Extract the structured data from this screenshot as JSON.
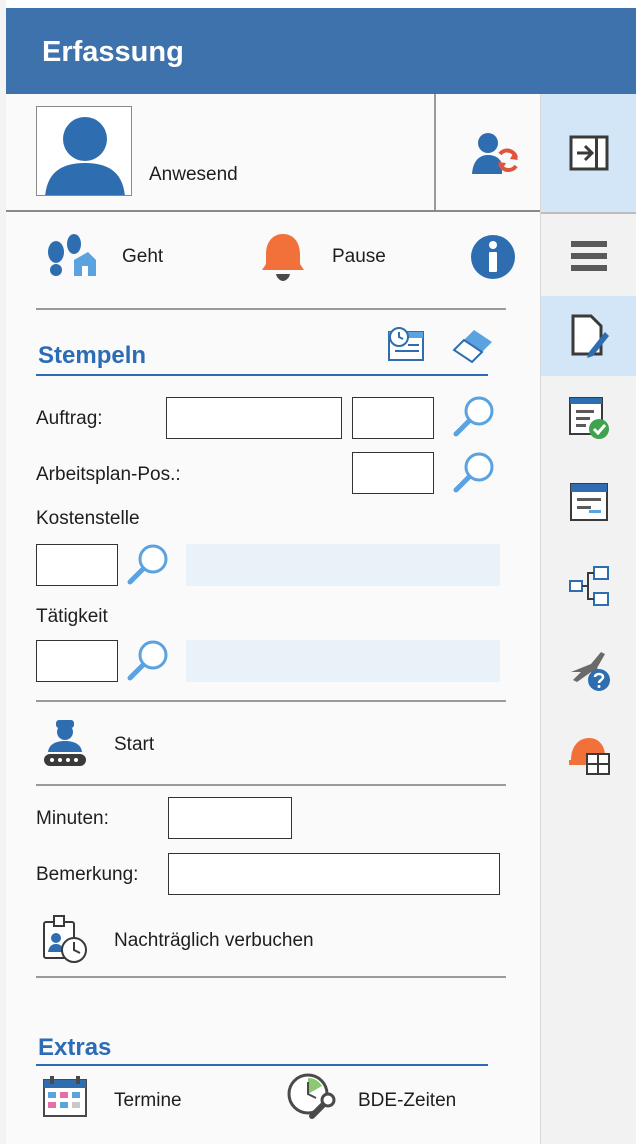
{
  "window": {
    "title": "Erfassung"
  },
  "status": {
    "text": "Anwesend"
  },
  "actions": {
    "geht": "Geht",
    "pause": "Pause"
  },
  "stempeln": {
    "title": "Stempeln",
    "auftrag_label": "Auftrag:",
    "arbeitsplan_label": "Arbeitsplan-Pos.:",
    "kostenstelle_label": "Kostenstelle",
    "taetigkeit_label": "Tätigkeit",
    "start_label": "Start",
    "auftrag_value": "",
    "auftrag_pos_value": "",
    "arbeitsplan_value": "",
    "kostenstelle_value": "",
    "taetigkeit_value": ""
  },
  "booking": {
    "minuten_label": "Minuten:",
    "minuten_value": "",
    "bemerkung_label": "Bemerkung:",
    "bemerkung_value": "",
    "nachtraeglich_label": "Nachträglich verbuchen"
  },
  "extras": {
    "title": "Extras",
    "termine": "Termine",
    "bde_zeiten": "BDE-Zeiten"
  },
  "colors": {
    "titlebar": "#3d72ad",
    "accent": "#2c6bb5",
    "active_tab": "#d3e6f8",
    "pause_bell": "#f2713a",
    "search": "#5aa3e0"
  },
  "sidebar_icons": [
    "collapse-panel-icon",
    "menu-icon",
    "edit-document-icon",
    "checklist-icon",
    "window-icon",
    "network-icon",
    "travel-help-icon",
    "worker-table-icon"
  ]
}
